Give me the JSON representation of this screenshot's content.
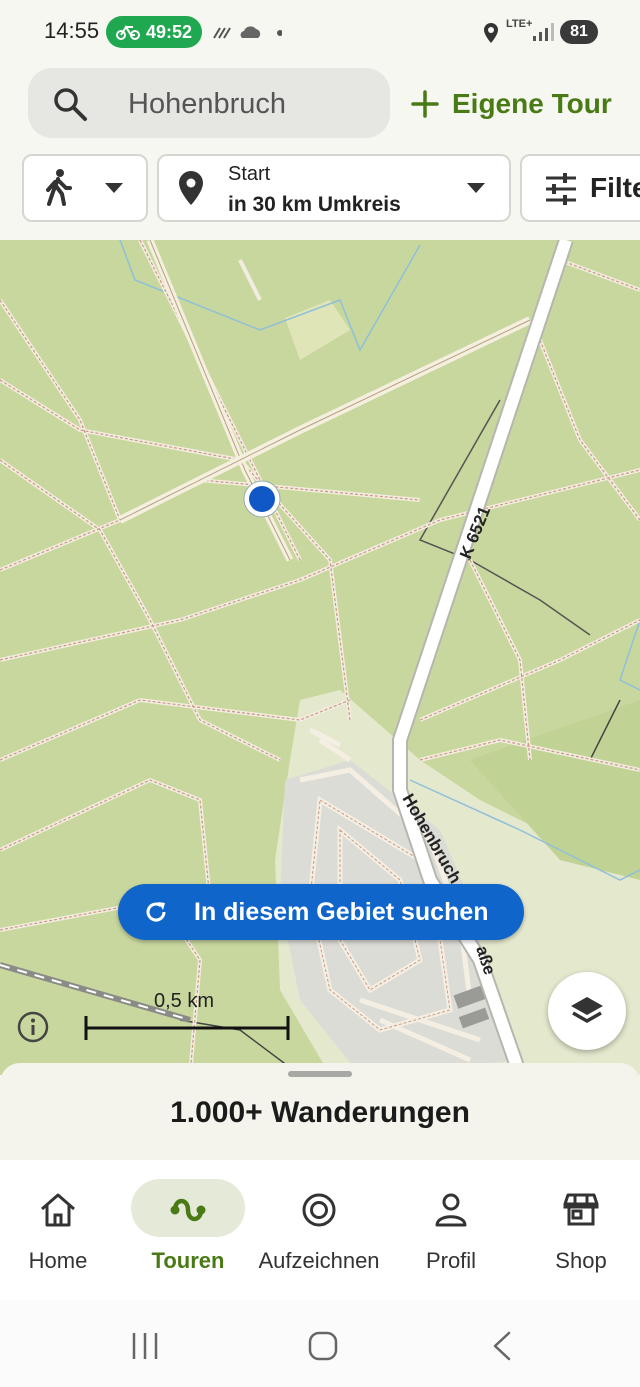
{
  "status": {
    "time": "14:55",
    "ride_timer": "49:52",
    "network": "LTE+",
    "battery": "81"
  },
  "header": {
    "search_value": "Hohenbruch",
    "own_tour_label": "Eigene Tour"
  },
  "filters": {
    "start_label": "Start",
    "radius_label": "in 30 km Umkreis",
    "filter_label": "Filter"
  },
  "map": {
    "road_label": "K 6521",
    "street_label": "Hohenbruch",
    "street_label_end": "aße",
    "search_area_button": "In diesem Gebiet suchen",
    "scale_label": "0,5 km"
  },
  "sheet": {
    "result_count": "1.000+ Wanderungen"
  },
  "nav": {
    "items": [
      {
        "label": "Home",
        "icon": "home-icon"
      },
      {
        "label": "Touren",
        "icon": "touren-icon"
      },
      {
        "label": "Aufzeichnen",
        "icon": "record-icon"
      },
      {
        "label": "Profil",
        "icon": "profile-icon"
      },
      {
        "label": "Shop",
        "icon": "shop-icon"
      }
    ],
    "active": "Touren"
  },
  "colors": {
    "brand_green": "#4a7a15",
    "primary_blue": "#0f65c9",
    "map_forest": "#c8d79e"
  }
}
